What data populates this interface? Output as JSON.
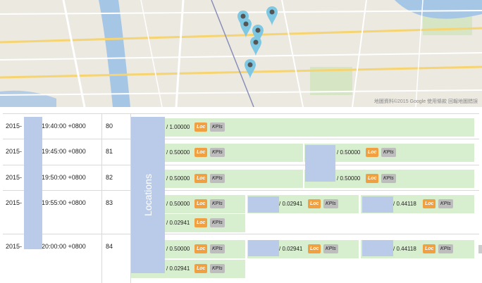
{
  "map": {
    "attribution": "地圖資料©2015 Google  使用條款  回報地圖錯誤",
    "pins": 6
  },
  "rows": [
    {
      "year": "2015-",
      "time": "19:40:00 +0800",
      "id": "80",
      "entries": [
        {
          "value": "/ 1.00000",
          "loc": "Loc",
          "kpi": "KPIs"
        }
      ]
    },
    {
      "year": "2015-",
      "time": "19:45:00 +0800",
      "id": "81",
      "entries": [
        {
          "value": "/ 0.50000",
          "loc": "Loc",
          "kpi": "KPIs"
        },
        {
          "value": "/ 0.50000",
          "loc": "Loc",
          "kpi": "KPIs"
        }
      ]
    },
    {
      "year": "2015-",
      "time": "19:50:00 +0800",
      "id": "82",
      "entries": [
        {
          "value": "/ 0.50000",
          "loc": "Loc",
          "kpi": "KPIs"
        },
        {
          "value": "/ 0.50000",
          "loc": "Loc",
          "kpi": "KPIs"
        }
      ]
    },
    {
      "year": "2015-",
      "time": "19:55:00 +0800",
      "id": "83",
      "entries": [
        {
          "value": "/ 0.50000",
          "loc": "Loc",
          "kpi": "KPIs"
        },
        {
          "value": "/ 0.02941",
          "loc": "Loc",
          "kpi": "KPIs"
        },
        {
          "value": "/ 0.44118",
          "loc": "Loc",
          "kpi": "KPIs"
        },
        {
          "value": "/ 0.02941",
          "loc": "Loc",
          "kpi": "KPIs"
        }
      ]
    },
    {
      "year": "2015-",
      "time": "20:00:00 +0800",
      "id": "84",
      "entries": [
        {
          "value": "/ 0.50000",
          "loc": "Loc",
          "kpi": "KPIs"
        },
        {
          "value": "/ 0.02941",
          "loc": "Loc",
          "kpi": "KPIs"
        },
        {
          "value": "/ 0.44118",
          "loc": "Loc",
          "kpi": "KPIs"
        },
        {
          "value": "/ 0.02941",
          "loc": "Loc",
          "kpi": "KPIs"
        }
      ]
    }
  ],
  "locations_label": "Locations",
  "colors": {
    "bar": "#d8efcf",
    "loc_tag": "#f0a040",
    "kpi_tag": "#bdbdbd",
    "highlight": "#b9cbe9",
    "pin": "#7ec8e3"
  }
}
